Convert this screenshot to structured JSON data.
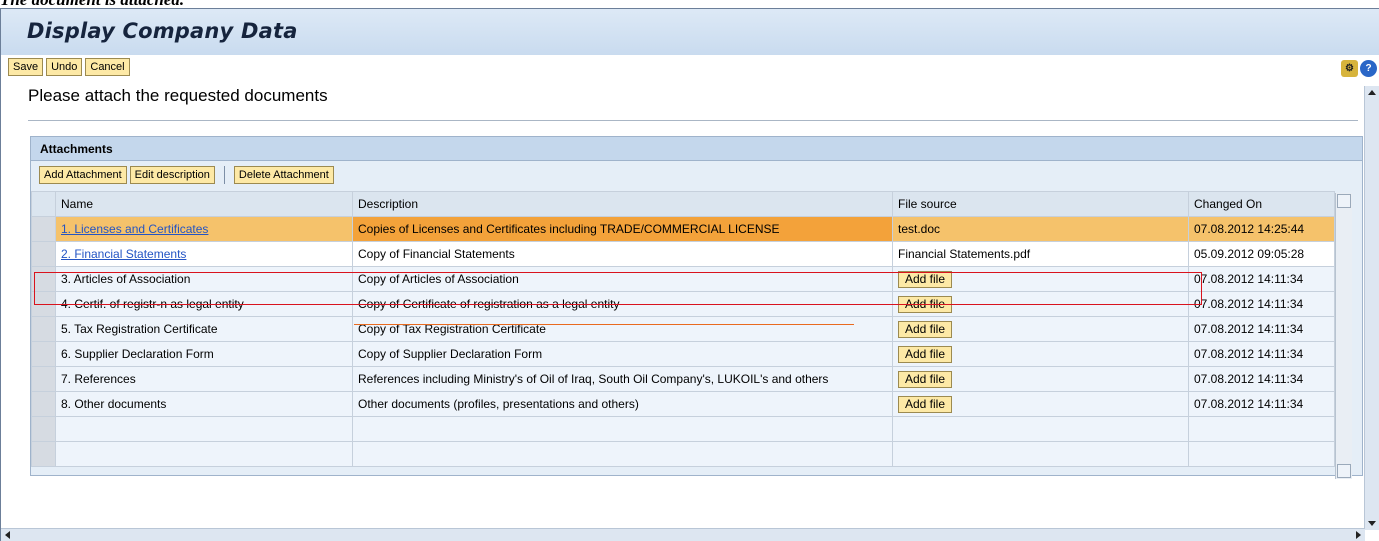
{
  "caption": "The document is attached.",
  "app": {
    "title": "Display Company Data"
  },
  "toolbar": {
    "save_label": "Save",
    "undo_label": "Undo",
    "cancel_label": "Cancel"
  },
  "page": {
    "heading": "Please attach the requested documents"
  },
  "attachments": {
    "title": "Attachments",
    "buttons": {
      "add": "Add Attachment",
      "edit": "Edit description",
      "delete": "Delete Attachment"
    },
    "columns": [
      "Name",
      "Description",
      "File source",
      "Changed On"
    ],
    "add_file_label": "Add file",
    "rows": [
      {
        "name": "1. Licenses and Certificates",
        "description": "Copies of Licenses and Certificates including TRADE/COMMERCIAL LICENSE",
        "file_source": "test.doc",
        "changed_on": "07.08.2012 14:25:44"
      },
      {
        "name": "2. Financial Statements",
        "description": "Copy of Financial Statements",
        "file_source": "Financial Statements.pdf",
        "changed_on": "05.09.2012 09:05:28"
      },
      {
        "name": "3. Articles of Association",
        "description": "Copy of Articles of Association",
        "file_source": "",
        "changed_on": "07.08.2012 14:11:34"
      },
      {
        "name": "4. Certif. of registr-n as legal entity",
        "description": "Copy of Certificate of registration as a legal entity",
        "file_source": "",
        "changed_on": "07.08.2012 14:11:34"
      },
      {
        "name": "5. Tax Registration Certificate",
        "description": "Copy of Tax Registration Certificate",
        "file_source": "",
        "changed_on": "07.08.2012 14:11:34"
      },
      {
        "name": "6. Supplier Declaration Form",
        "description": "Copy of Supplier Declaration Form",
        "file_source": "",
        "changed_on": "07.08.2012 14:11:34"
      },
      {
        "name": "7. References",
        "description": "References including Ministry's of Oil of Iraq, South Oil Company's, LUKOIL's and others",
        "file_source": "",
        "changed_on": "07.08.2012 14:11:34"
      },
      {
        "name": "8. Other documents",
        "description": "Other documents (profiles, presentations and others)",
        "file_source": "",
        "changed_on": "07.08.2012 14:11:34"
      }
    ]
  },
  "colors": {
    "title_bar": "#c9dbef",
    "button": "#fde9a6",
    "row_highlight": "#f5c26b",
    "highlight_box": "#d9131d"
  }
}
